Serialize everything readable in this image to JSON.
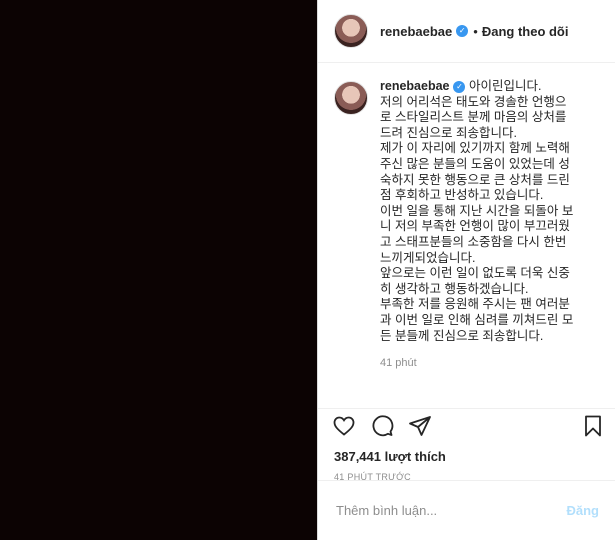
{
  "post": {
    "username": "renebaebae",
    "follow_status": "Đang theo dõi",
    "caption_lines": [
      "아이린입니다.",
      "저의 어리석은 태도와 경솔한 언행으",
      "로 스타일리스트 분께 마음의 상처를",
      "드려 진심으로 죄송합니다.",
      "제가 이 자리에 있기까지 함께 노력해",
      "주신 많은 분들의 도움이 있었는데 성",
      "숙하지 못한 행동으로 큰 상처를 드린",
      "점 후회하고 반성하고 있습니다.",
      "이번 일을 통해 지난 시간을 되돌아 보",
      "니 저의 부족한 언행이 많이 부끄러웠",
      "고 스태프분들의 소중함을 다시 한번",
      "느끼게되었습니다.",
      "앞으로는 이런 일이 없도록 더욱 신중",
      "히 생각하고 행동하겠습니다.",
      "부족한 저를 응원해 주시는 팬 여러분",
      "과 이번 일로 인해 심려를 끼쳐드린 모",
      "든 분들께 진심으로 죄송합니다."
    ],
    "caption_time": "41 phút",
    "likes": "387,441 lượt thích",
    "posted_time": "41 PHÚT TRƯỚC"
  },
  "comment": {
    "placeholder": "Thêm bình luận...",
    "post_label": "Đăng"
  },
  "icons": {
    "heart": "heart-icon",
    "comment": "comment-icon",
    "share": "share-icon",
    "bookmark": "bookmark-icon"
  },
  "colors": {
    "verified": "#3897f0",
    "post_disabled": "#b2dffc",
    "background_media": "#0c0303"
  }
}
